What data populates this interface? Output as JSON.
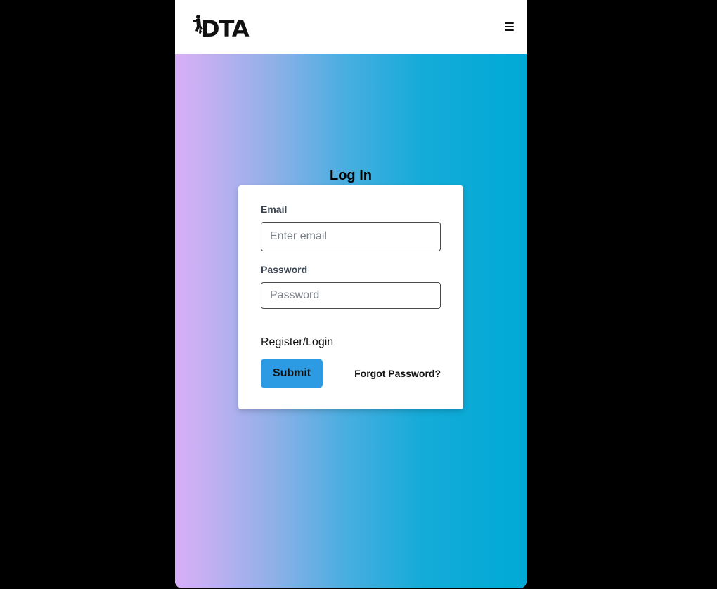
{
  "navbar": {
    "logo_text": "DTA",
    "logo_icon": "dta-logo-with-figure",
    "menu_icon": "hamburger-menu-icon"
  },
  "page": {
    "title": "Log In",
    "gradient_colors": [
      "#d8aef8",
      "#00aad6"
    ]
  },
  "form": {
    "email_label": "Email",
    "email_placeholder": "Enter email",
    "email_value": "",
    "password_label": "Password",
    "password_placeholder": "Password",
    "password_value": "",
    "register_link": "Register/Login",
    "submit_label": "Submit",
    "submit_color": "#2c9be4",
    "forgot_link": "Forgot Password?"
  }
}
